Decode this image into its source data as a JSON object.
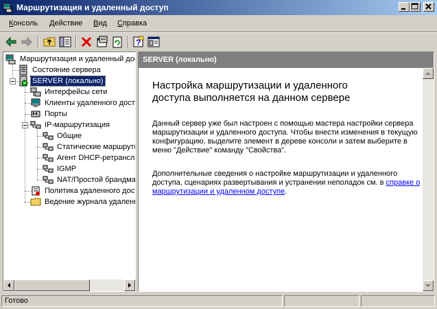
{
  "window": {
    "title": "Маршрутизация и удаленный доступ"
  },
  "menu": {
    "items": [
      {
        "label": "Консоль",
        "accel": "К"
      },
      {
        "label": "Действие",
        "accel": "Д"
      },
      {
        "label": "Вид",
        "accel": "В"
      },
      {
        "label": "Справка",
        "accel": "С"
      }
    ]
  },
  "toolbar": {
    "icons": [
      "back-arrow-icon",
      "forward-arrow-icon",
      "up-folder-icon",
      "show-hide-tree-icon",
      "delete-icon",
      "properties-icon",
      "refresh-icon",
      "help-icon",
      "console-tree-icon"
    ]
  },
  "tree": {
    "root": "Маршрутизация и удаленный доступ",
    "server_status": "Состояние сервера",
    "server": "SERVER (локально)",
    "interfaces": "Интерфейсы сети",
    "clients": "Клиенты удаленного доступа",
    "ports": "Порты",
    "ip_routing": "IP-маршрутизация",
    "general": "Общие",
    "static_routes": "Статические маршруты",
    "dhcp_agent": "Агент DHCP-ретрансляции",
    "igmp": "IGMP",
    "nat": "NAT/Простой брандмауэр",
    "policy": "Политика удаленного доступа",
    "logging": "Ведение журнала удаленного доступа"
  },
  "content": {
    "header": "SERVER (локально)",
    "heading": "Настройка маршрутизации и удаленного доступа выполняется на данном сервере",
    "para1": "Данный сервер уже был настроен с помощью мастера настройки сервера маршрутизации и удаленного доступа. Чтобы внести изменения в текущую конфигурацию, выделите элемент в дереве консоли и затем выберите в меню \"Действие\" команду \"Свойства\".",
    "para2_prefix": "Дополнительные сведения о настройке маршрутизации и удаленного доступа, сценариях развертывания и устранении неполадок см. в ",
    "para2_link": "справке о маршрутизации и удаленном доступе",
    "para2_suffix": "."
  },
  "status": {
    "text": "Готово"
  },
  "colors": {
    "title_start": "#0a246a",
    "title_end": "#a6caf0",
    "header_bg": "#808080",
    "link": "#0000ff",
    "selection": "#0a246a"
  }
}
